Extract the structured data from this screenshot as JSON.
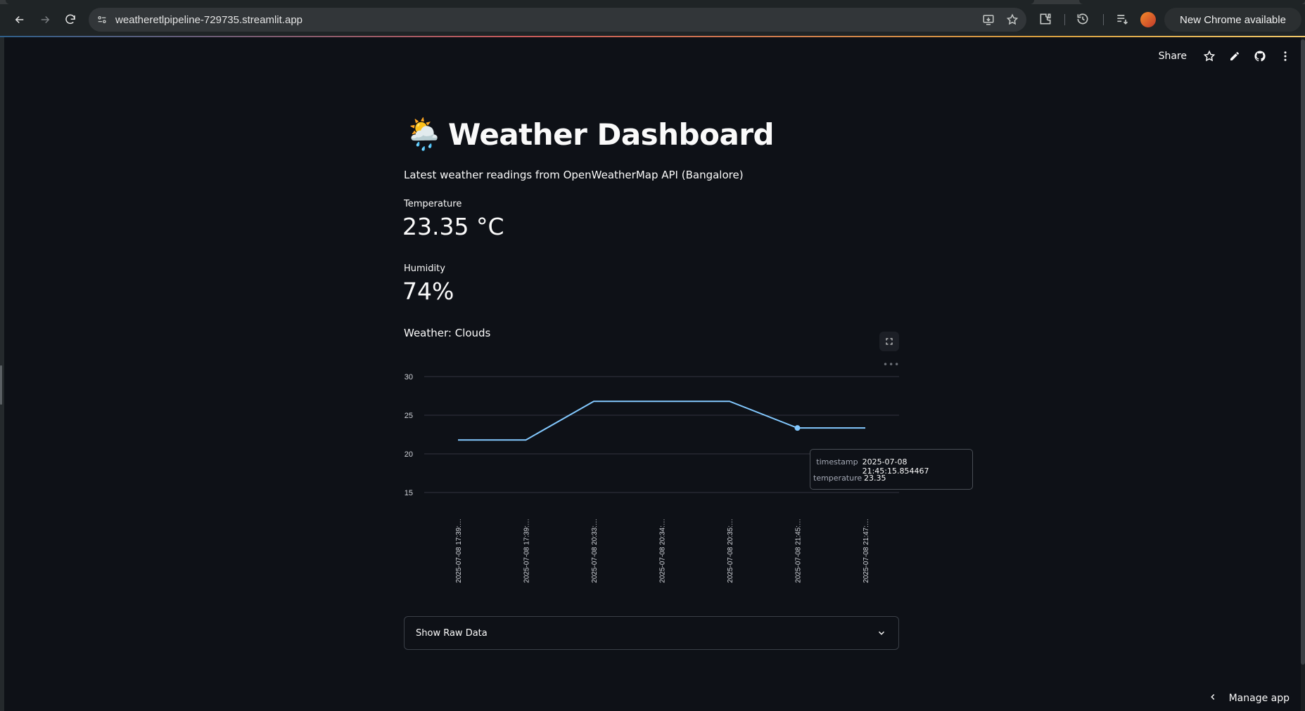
{
  "browser": {
    "url": "weatheretlpipeline-729735.streamlit.app",
    "update_label": "New Chrome available"
  },
  "toolbar": {
    "share_label": "Share"
  },
  "page": {
    "emoji": "🌦️",
    "title": "Weather Dashboard",
    "subtitle": "Latest weather readings from OpenWeatherMap API (Bangalore)"
  },
  "metrics": [
    {
      "label": "Temperature",
      "value": "23.35 °C"
    },
    {
      "label": "Humidity",
      "value": "74%"
    }
  ],
  "weather_label": "Weather: Clouds",
  "chart_data": {
    "type": "line",
    "x": [
      "2025-07-08 17:39:…",
      "2025-07-08 17:39:…",
      "2025-07-08 20:33:…",
      "2025-07-08 20:34:…",
      "2025-07-08 20:35:…",
      "2025-07-08 21:45:…",
      "2025-07-08 21:47:…"
    ],
    "series": [
      {
        "values": [
          21.8,
          21.8,
          26.8,
          26.8,
          26.8,
          23.35,
          23.35
        ]
      }
    ],
    "yticks": [
      15,
      20,
      25,
      30
    ],
    "ylim": [
      15,
      30
    ],
    "grid": true,
    "line_color": "#83c9ff",
    "highlight_index": 5
  },
  "tooltip": {
    "timestamp_key": "timestamp",
    "timestamp_value": "2025-07-08 21:45:15.854467",
    "temperature_key": "temperature",
    "temperature_value": "23.35"
  },
  "expander": {
    "label": "Show Raw Data"
  },
  "manage_app_label": "Manage app",
  "colors": {
    "background": "#0e1117",
    "accent_line": "#83c9ff"
  }
}
